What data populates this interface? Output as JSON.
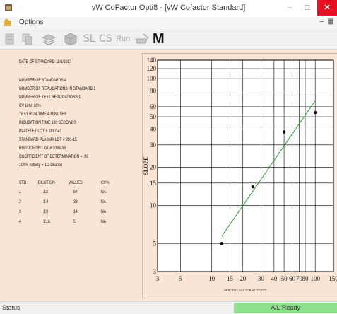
{
  "window": {
    "title": "vW CoFactor Opti8 - [vW Cofactor Standard]"
  },
  "menu": {
    "options_label": "Options"
  },
  "toolbar": {
    "sl_label": "SL",
    "cs_label": "CS",
    "run_label": "Run",
    "m_label": "M"
  },
  "info": {
    "date": "DATE OF STANDARD 11/6/2017",
    "num_standards": "NUMBER OF STANDARDS 4",
    "num_replications_std": "NUMBER OF REPLICATIONS IN STANDARD 1",
    "num_test_reps": "NUMBER OF TEST REPLICATIONS 1",
    "cv_limit": "CV Limit 10%",
    "test_run_time": "TEST RUN TIME 4 MINUTES",
    "incubation_time": "INCUBATION TIME 120 SECONDS",
    "platelet_lot": "PLATELET LOT # 1887-41",
    "plasma_lot": "STANDARD PLASMA LOT # 291-15",
    "ristocetin_lot": "RISTOCETIN LOT # 1088-33",
    "coefficient": "COEFFICIENT OF DETERMINATION = .96",
    "activity": "100% Activity = 1:2 Dilution"
  },
  "table": {
    "headers": [
      "STD",
      "DILUTION",
      "VALUES",
      "CV%"
    ],
    "rows": [
      [
        "1",
        "1:2",
        "54",
        "NA"
      ],
      [
        "2",
        "1:4",
        "38",
        "NA"
      ],
      [
        "3",
        "1:8",
        "14",
        "NA"
      ],
      [
        "4",
        "1:16",
        "5",
        "NA"
      ]
    ]
  },
  "status": {
    "left": "Status",
    "right": "A/L Ready"
  },
  "chart_data": {
    "type": "scatter",
    "xlabel": "PERCENT FACTOR ACTIVITY",
    "ylabel": "SLOPE",
    "x_scale": "log",
    "y_scale": "log",
    "xlim": [
      3,
      150
    ],
    "ylim": [
      3,
      140
    ],
    "x_ticks": [
      3,
      5,
      10,
      15,
      20,
      30,
      40,
      50,
      60,
      70,
      80,
      100,
      150
    ],
    "y_ticks": [
      3,
      5,
      10,
      15,
      20,
      30,
      40,
      50,
      60,
      80,
      100,
      120,
      140
    ],
    "grid": true,
    "points": [
      {
        "x": 12.5,
        "y": 5
      },
      {
        "x": 25,
        "y": 14
      },
      {
        "x": 50,
        "y": 38
      },
      {
        "x": 100,
        "y": 54
      }
    ],
    "fit_line": {
      "x0": 12.5,
      "y0": 5.7,
      "x1": 100,
      "y1": 67
    },
    "colors": {
      "points": "#000000",
      "fit_line": "#2e9e2e",
      "grid": "#000000"
    }
  }
}
